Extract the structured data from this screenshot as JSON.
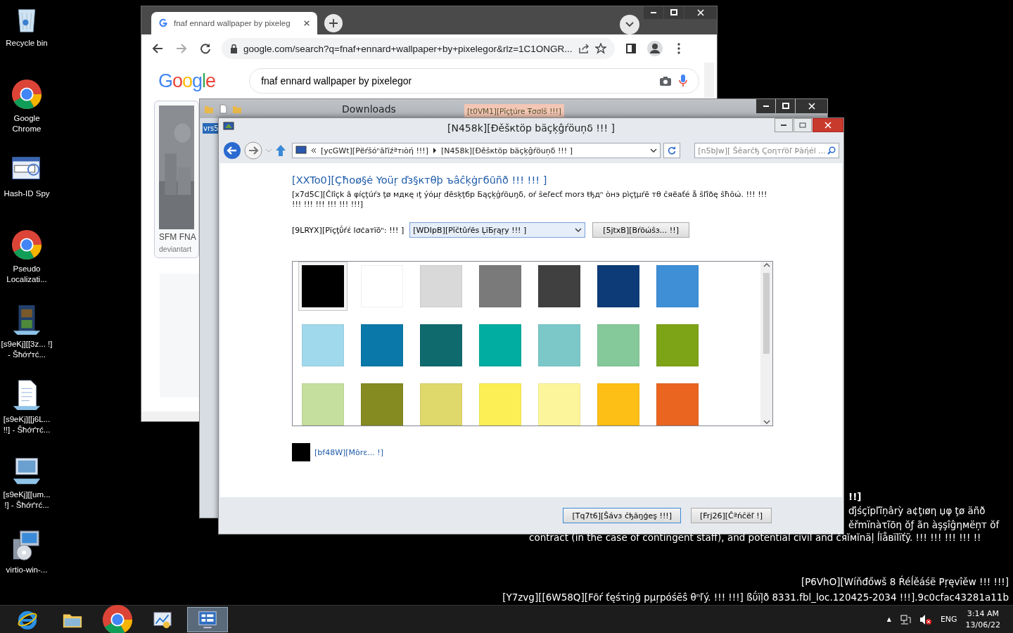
{
  "desktop_icons": [
    {
      "label": "Recycle bin",
      "kind": "recycle"
    },
    {
      "label": "Google Chrome",
      "kind": "chrome"
    },
    {
      "label": "Hash-ID Spy",
      "kind": "hashid"
    },
    {
      "label": "Pseudo Localizati...",
      "kind": "chrome"
    },
    {
      "label": "[s9eKj][[3z... !] - Šħớґтć...",
      "kind": "video"
    },
    {
      "label": "[s9eKj][[j6L... !!] - Šħớґтć...",
      "kind": "document"
    },
    {
      "label": "[s9eKj][[um... !] - Šħớґтć...",
      "kind": "computer"
    },
    {
      "label": "virtio-win-...",
      "kind": "installer"
    }
  ],
  "browser": {
    "tab_title": "fnaf ennard wallpaper by pixeleg",
    "logo": "Google",
    "url": "google.com/search?q=fnaf+ennard+wallpaper+by+pixelegor&rlz=1C1ONGR...",
    "search_query": "fnaf ennard wallpaper by pixelegor",
    "result_title": "SFM FNA",
    "result_source": "deviantart"
  },
  "explorer": {
    "title": "Downloads",
    "context_tab": "[t0VM1][Pĭçţúre Ŧσσlš !!!]",
    "side_text": "vrs5"
  },
  "dialog": {
    "title": "[N458k][Ðěšкtöp bäçķĝŕöuņδ !!! ]",
    "breadcrumbs": [
      "[ycGWt][Pёŕšóⁿāľĩźªтıòή !!!]",
      "[N458k][Ðěšкtöp bäçķĝŕöuņδ !!! ]"
    ],
    "search_placeholder": "[n5bJw][ Šêarĉђ Çoηтŕöľ Þàήél ...",
    "heading": "[XXTo0][Çħoø§ė Yoüŗ ďз§ктθþ ъâĉķġгбūñð !!! !!! ]",
    "description": "[x7d5C][Ĉlîçk â φíçţúŕз ţø мдкę ıţ ýóμŗ đēsķţбp Бąçķǵŕõџŋδ, oŕ ŝeľecť morз ŧђдⁿ òнэ pìçţμŕē тθ ĉяёaťé å ŝľîðę ŝħôώ. !!! !!! !!! !!! !!! !!! !!! !!!]",
    "location_label": "[9LRYX][Pïçţΰŕέ lσċaтïōⁿ: !!! ]",
    "location_value": "[WDIpB][Pĭčtûŕēs ĻïБŗąŗy !!! ]",
    "browse_button": "[5jtxB][Bŕõώŝз... !!]",
    "swatches": [
      {
        "color": "#000000",
        "selected": true
      },
      {
        "color": "#ffffff",
        "selected": false
      },
      {
        "color": "#d9d9d9",
        "selected": false
      },
      {
        "color": "#7a7a7a",
        "selected": false
      },
      {
        "color": "#404040",
        "selected": false
      },
      {
        "color": "#0c3b78",
        "selected": false
      },
      {
        "color": "#3e8fd6",
        "selected": false
      },
      {
        "color": "#a0d8ec",
        "selected": false
      },
      {
        "color": "#0a78a8",
        "selected": false
      },
      {
        "color": "#0f6a6e",
        "selected": false
      },
      {
        "color": "#00ada0",
        "selected": false
      },
      {
        "color": "#7cc8c8",
        "selected": false
      },
      {
        "color": "#85c89a",
        "selected": false
      },
      {
        "color": "#7da317",
        "selected": false
      },
      {
        "color": "#c5df9e",
        "selected": false
      },
      {
        "color": "#858a21",
        "selected": false
      },
      {
        "color": "#dfd86b",
        "selected": false
      },
      {
        "color": "#fcef55",
        "selected": false
      },
      {
        "color": "#fdf59b",
        "selected": false
      },
      {
        "color": "#fdbf15",
        "selected": false
      },
      {
        "color": "#e96520",
        "selected": false
      }
    ],
    "more_link": "[bf48W][Mõrε... !]",
    "save_button": "[Tq7t6][Ŝávз ĉђăŋģeş !!!]",
    "cancel_button": "[Frj26][Ĉªńĉëľ !]"
  },
  "desktop_text": {
    "partial_lines": [
      "!!]",
      "ďjśçĭpľĩņârỳ a¢ţıøη џφ ţø äñð",
      "ěřmïnàτĩōη ŏƒ ãn àşşîĝηмëņт ŏf"
    ],
    "last_line": "contract (in the case of contingent staff), and potential civil and čяĭмĭnäļ ĺĭåвïlïťÿ. !!! !!! !!! !!! !!",
    "footer": [
      "[P6VhO][Wíňđőwš 8 Ŕéĺěáśë Pŗęvîěw !!! !!!]",
      "[Y7zvg][[6W58Q][Fōŕ ťęśτiŋğ pμŗpóśēŝ θⁿľý. !!! !!!] ßΰïļð 8331.fbl_loc.120425-2034 !!!].9c0cfac43281a11b"
    ]
  },
  "taskbar": {
    "apps": [
      {
        "kind": "ie",
        "selected": false
      },
      {
        "kind": "explorer",
        "selected": false
      },
      {
        "kind": "chrome",
        "selected": false
      },
      {
        "kind": "tools",
        "selected": false
      },
      {
        "kind": "display",
        "selected": true
      }
    ],
    "tray": {
      "overflow": "▲",
      "language": "ENG",
      "time": "3:14 AM",
      "date": "13/06/22"
    }
  }
}
